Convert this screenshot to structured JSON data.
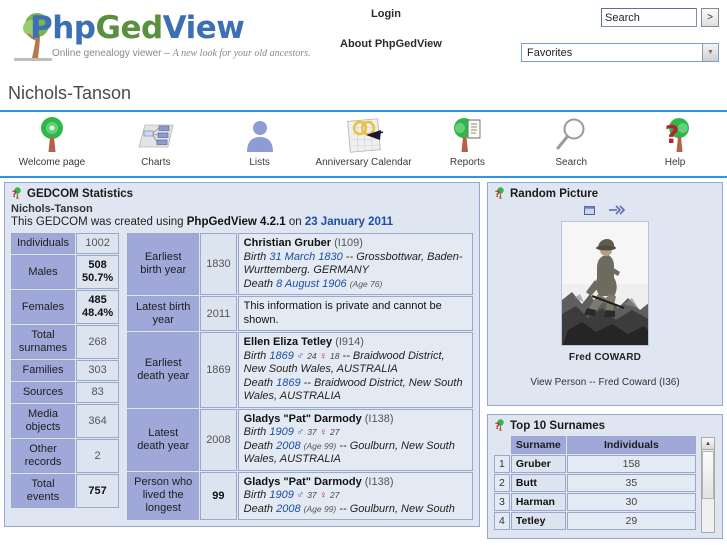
{
  "header": {
    "logo": {
      "part1": "P",
      "part2": "hp",
      "part3": "Ged",
      "part4": "View",
      "tagline_plain": "Online genealogy viewer – ",
      "tagline_italic": "A new look for your old ancestors."
    },
    "login_label": "Login",
    "about_label": "About PhpGedView",
    "search": {
      "value": "Search",
      "placeholder": "Search",
      "go_label": ">"
    },
    "favorites": {
      "selected": "Favorites"
    }
  },
  "page_title": "Nichols-Tanson",
  "nav": {
    "items": [
      {
        "label": "Welcome page",
        "icon": "tree-icon"
      },
      {
        "label": "Charts",
        "icon": "chart-icon"
      },
      {
        "label": "Lists",
        "icon": "person-icon"
      },
      {
        "label": "Anniversary Calendar",
        "icon": "calendar-icon"
      },
      {
        "label": "Reports",
        "icon": "report-icon"
      },
      {
        "label": "Search",
        "icon": "magnifier-icon"
      },
      {
        "label": "Help",
        "icon": "help-icon"
      }
    ]
  },
  "gedcom_stats": {
    "block_title": "GEDCOM Statistics",
    "subtitle": "Nichols-Tanson",
    "created_prefix": "This GEDCOM was created using ",
    "created_app": "PhpGedView 4.2.1",
    "created_on": " on ",
    "created_date": "23 January 2011",
    "counts": [
      {
        "label": "Individuals",
        "value": "1002",
        "pct": "",
        "bold": false
      },
      {
        "label": "Males",
        "value": "508",
        "pct": "50.7%",
        "bold": true
      },
      {
        "label": "Females",
        "value": "485",
        "pct": "48.4%",
        "bold": true
      },
      {
        "label": "Total surnames",
        "value": "268",
        "pct": "",
        "bold": false
      },
      {
        "label": "Families",
        "value": "303",
        "pct": "",
        "bold": false
      },
      {
        "label": "Sources",
        "value": "83",
        "pct": "",
        "bold": false
      },
      {
        "label": "Media objects",
        "value": "364",
        "pct": "",
        "bold": false
      },
      {
        "label": "Other records",
        "value": "2",
        "pct": "",
        "bold": false
      },
      {
        "label": "Total events",
        "value": "757",
        "pct": "",
        "bold": true
      }
    ],
    "events": [
      {
        "label": "Earliest birth year",
        "year": "1830",
        "year_bold": false,
        "private": false,
        "name": "Christian Gruber",
        "xref": "(I109)",
        "birth_prefix": "Birth ",
        "birth_date": "31 March 1830",
        "birth_place": " -- Grossbottwar, Baden-Wurttemberg. GERMANY",
        "birth_male": "",
        "birth_female": "",
        "death_prefix": "Death ",
        "death_date": "8 August 1906",
        "death_age": "(Age 76)",
        "death_place": ""
      },
      {
        "label": "Latest birth year",
        "year": "2011",
        "year_bold": false,
        "private": true,
        "private_text": "This information is private and cannot be shown."
      },
      {
        "label": "Earliest death year",
        "year": "1869",
        "year_bold": false,
        "private": false,
        "name": "Ellen Eliza Tetley",
        "xref": "(I914)",
        "birth_prefix": "Birth ",
        "birth_date": "1869",
        "birth_male": "24",
        "birth_female": "18",
        "birth_place": " -- Braidwood District, New South Wales, AUSTRALIA",
        "death_prefix": "Death ",
        "death_date": "1869",
        "death_age": "",
        "death_place": " -- Braidwood District, New South Wales, AUSTRALIA"
      },
      {
        "label": "Latest death year",
        "year": "2008",
        "year_bold": false,
        "private": false,
        "name": "Gladys \"Pat\" Darmody",
        "xref": "(I138)",
        "birth_prefix": "Birth ",
        "birth_date": "1909",
        "birth_male": "37",
        "birth_female": "27",
        "birth_place": "",
        "death_prefix": "Death ",
        "death_date": "2008",
        "death_age": "(Age 99)",
        "death_place": " -- Goulburn, New South Wales, AUSTRALIA"
      },
      {
        "label": "Person who lived the longest",
        "year": "99",
        "year_bold": true,
        "private": false,
        "name": "Gladys \"Pat\" Darmody",
        "xref": "(I138)",
        "birth_prefix": "Birth ",
        "birth_date": "1909",
        "birth_male": "37",
        "birth_female": "27",
        "birth_place": "",
        "death_prefix": "Death ",
        "death_date": "2008",
        "death_age": "(Age 99)",
        "death_place": " -- Goulburn, New South"
      }
    ]
  },
  "random_picture": {
    "block_title": "Random Picture",
    "caption": "Fred COWARD",
    "view_link": "View Person -- Fred Coward  (I36)",
    "icons": [
      "window-icon",
      "fast-forward-icon"
    ]
  },
  "top_surnames": {
    "block_title": "Top 10 Surnames",
    "columns": [
      "Surname",
      "Individuals"
    ],
    "rows": [
      {
        "idx": "1",
        "surname": "Gruber",
        "count": "158"
      },
      {
        "idx": "2",
        "surname": "Butt",
        "count": "35"
      },
      {
        "idx": "3",
        "surname": "Harman",
        "count": "30"
      },
      {
        "idx": "4",
        "surname": "Tetley",
        "count": "29"
      }
    ],
    "scroll_up": "▲"
  },
  "colors": {
    "accent_blue": "#2e96e0",
    "panel_bg": "#dfe6f2",
    "panel_border": "#93a8cc",
    "label_bg": "#9fa8d8",
    "value_bg": "#dce4f0",
    "link_blue": "#1b4fa5"
  }
}
